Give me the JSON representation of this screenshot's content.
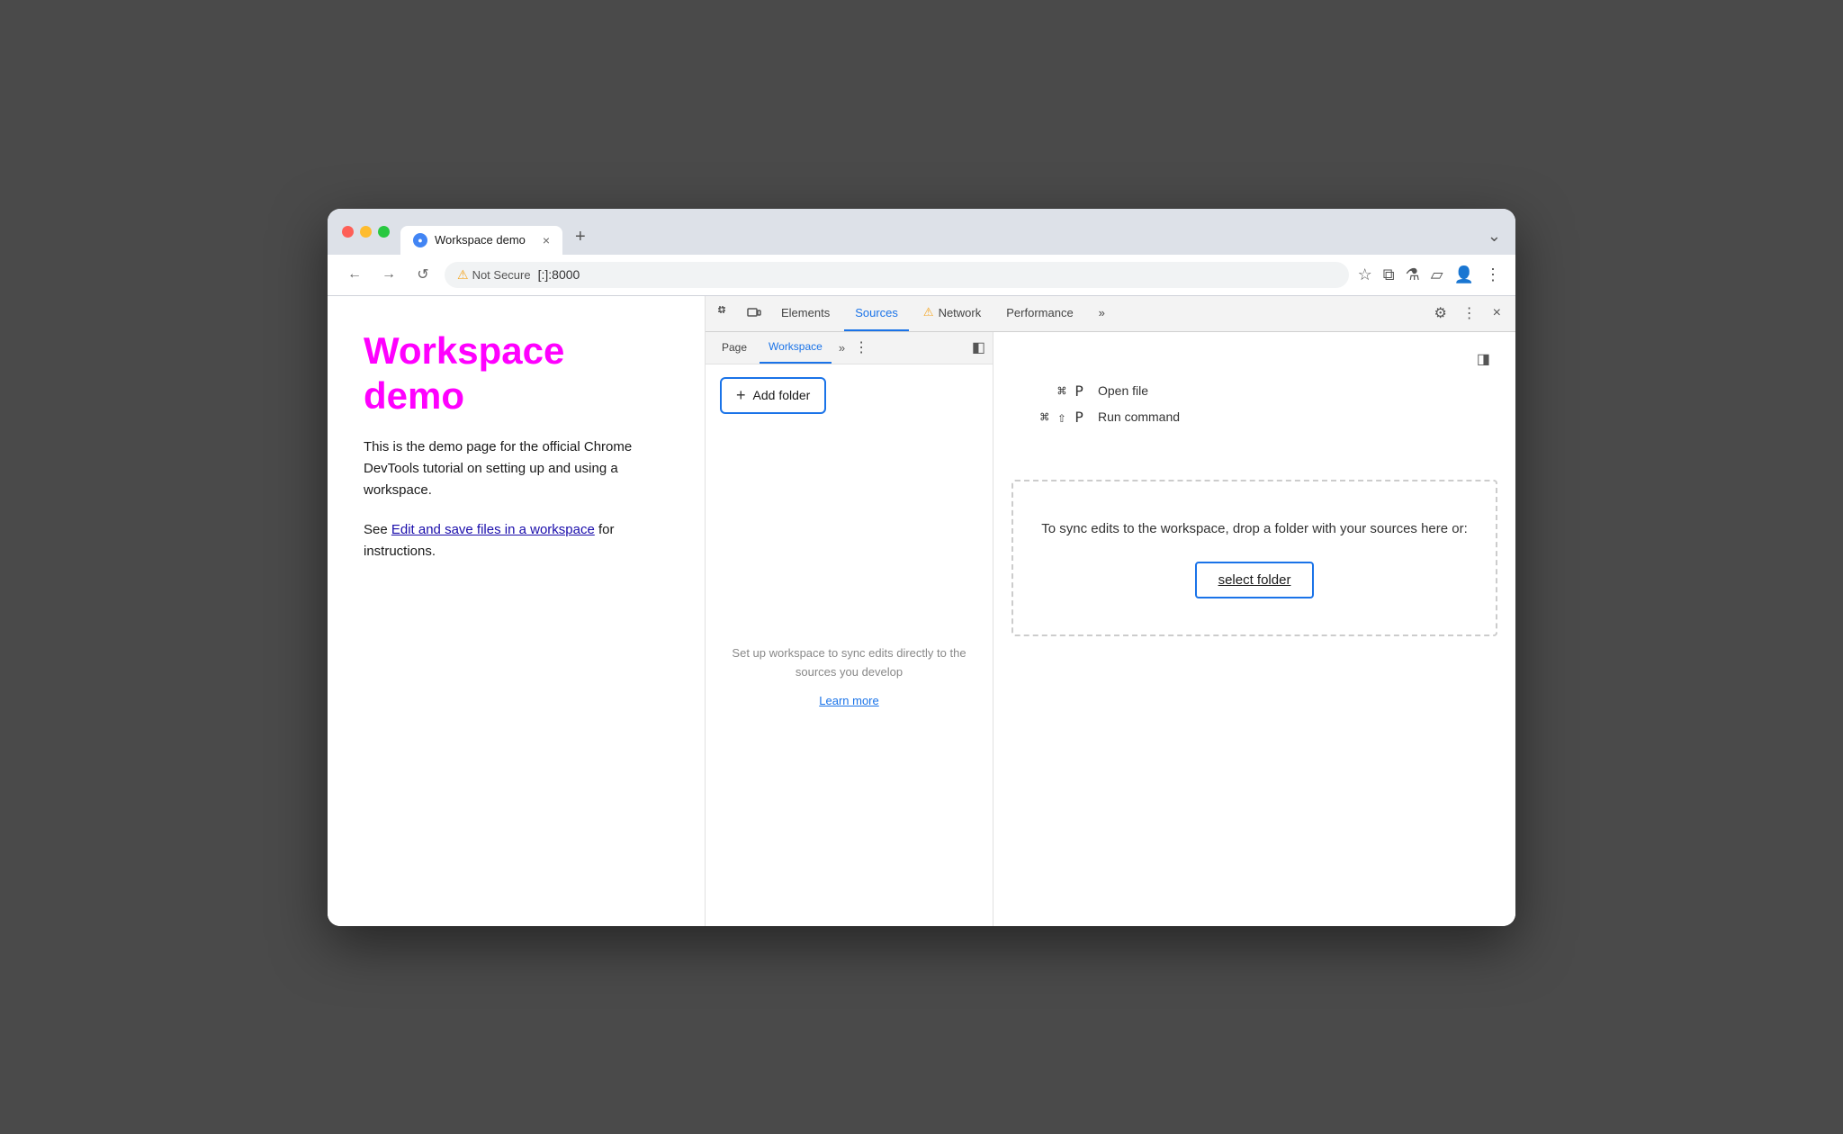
{
  "browser": {
    "tab_title": "Workspace demo",
    "tab_close": "×",
    "tab_new": "+",
    "tab_menu": "⌄",
    "not_secure_label": "Not Secure",
    "url": "[:]:8000",
    "nav_back": "←",
    "nav_forward": "→",
    "nav_reload": "↺"
  },
  "page": {
    "title": "Workspace demo",
    "description": "This is the demo page for the official Chrome DevTools tutorial on setting up and using a workspace.",
    "see_label": "See ",
    "link_text": "Edit and save files in a workspace",
    "instructions_label": " for instructions."
  },
  "devtools": {
    "tabs": [
      {
        "label": "Elements",
        "active": false
      },
      {
        "label": "Sources",
        "active": true
      },
      {
        "label": "Network",
        "active": false,
        "warning": true
      },
      {
        "label": "Performance",
        "active": false
      }
    ],
    "more_tabs": "»",
    "settings_icon": "⚙",
    "more_icon": "⋮",
    "close_icon": "×",
    "inspect_icon": "⬚",
    "device_icon": "⬜"
  },
  "sources": {
    "tabs": [
      {
        "label": "Page",
        "active": false
      },
      {
        "label": "Workspace",
        "active": true
      }
    ],
    "more_tabs": "»",
    "menu_icon": "⋮",
    "panel_toggle": "◧",
    "panel_toggle_right": "◨",
    "add_folder_label": "Add folder",
    "info_text": "Set up workspace to sync edits directly to the sources you develop",
    "learn_more": "Learn more",
    "shortcuts": [
      {
        "keys": "⌘ P",
        "label": "Open file"
      },
      {
        "keys": "⌘ ⇧ P",
        "label": "Run command"
      }
    ],
    "drop_zone_text": "To sync edits to the workspace, drop a folder with your sources here or:",
    "select_folder_label": "select folder"
  }
}
